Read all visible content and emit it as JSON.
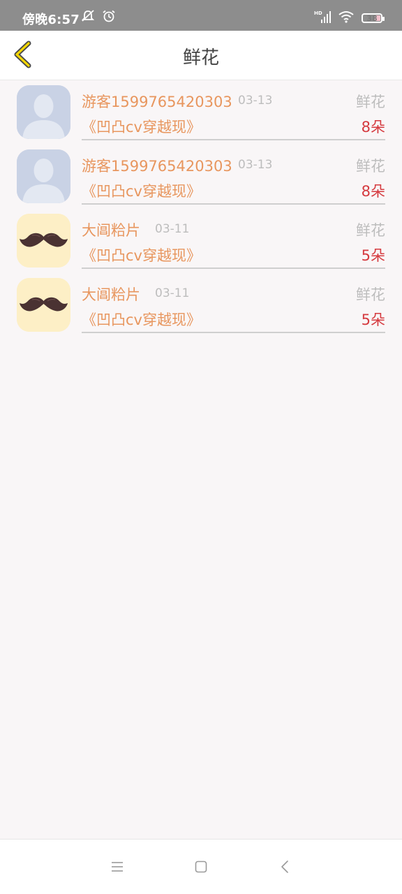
{
  "status_bar": {
    "time": "傍晚6:57",
    "battery": "38",
    "icons": [
      "mute-icon",
      "alarm-icon",
      "hd-signal-icon",
      "wifi-icon",
      "battery-icon"
    ]
  },
  "header": {
    "title": "鲜花",
    "back_icon": "chevron-left-icon"
  },
  "colors": {
    "accent_orange": "#e8965e",
    "count_red": "#d53a3f",
    "muted_gray": "#bdbdbd",
    "back_icon_yellow": "#f5d700"
  },
  "records": [
    {
      "avatar": "default-avatar",
      "user": "游客1599765420303",
      "date": "03-13",
      "gift": "鲜花",
      "book": "《凹凸cv穿越现》",
      "count": "8朵"
    },
    {
      "avatar": "default-avatar",
      "user": "游客1599765420303",
      "date": "03-13",
      "gift": "鲜花",
      "book": "《凹凸cv穿越现》",
      "count": "8朵"
    },
    {
      "avatar": "mustache-avatar",
      "user": "大阊粭片",
      "date": "03-11",
      "gift": "鲜花",
      "book": "《凹凸cv穿越现》",
      "count": "5朵"
    },
    {
      "avatar": "mustache-avatar",
      "user": "大阊粭片",
      "date": "03-11",
      "gift": "鲜花",
      "book": "《凹凸cv穿越现》",
      "count": "5朵"
    }
  ],
  "nav_bar": {
    "icons": [
      "menu-icon",
      "home-icon",
      "back-icon"
    ]
  }
}
